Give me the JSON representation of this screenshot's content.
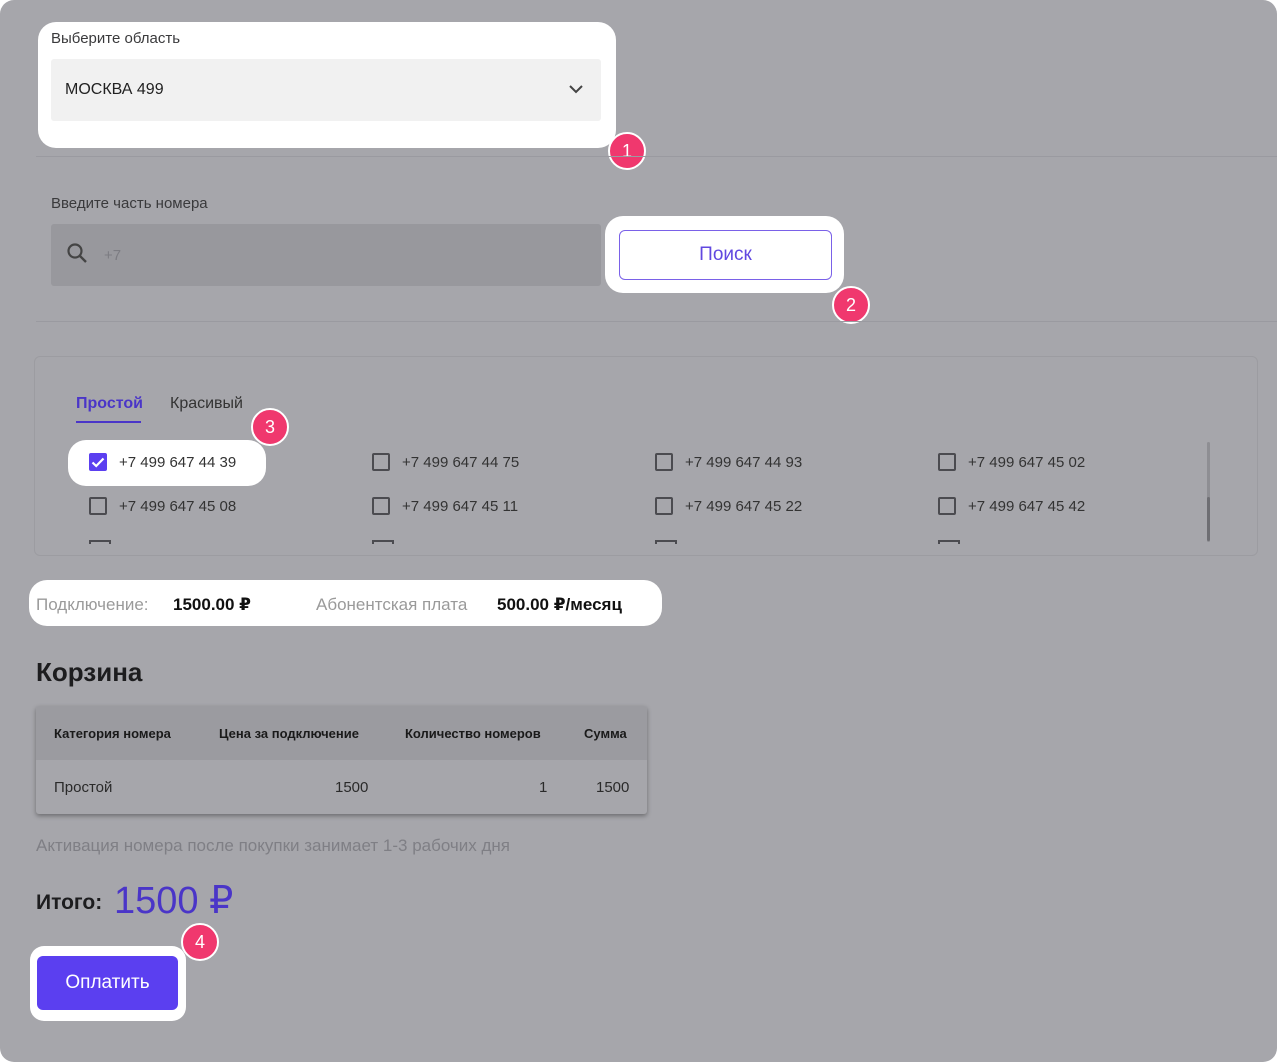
{
  "region": {
    "label": "Выберите область",
    "selected": "МОСКВА 499"
  },
  "search": {
    "label": "Введите часть номера",
    "placeholder": "+7",
    "button_label": "Поиск"
  },
  "tabs": [
    "Простой",
    "Красивый"
  ],
  "numbers": [
    {
      "number": "+7 499 647 44 39",
      "checked": true
    },
    {
      "number": "+7 499 647 44 75",
      "checked": false
    },
    {
      "number": "+7 499 647 44 93",
      "checked": false
    },
    {
      "number": "+7 499 647 45 02",
      "checked": false
    },
    {
      "number": "+7 499 647 45 08",
      "checked": false
    },
    {
      "number": "+7 499 647 45 11",
      "checked": false
    },
    {
      "number": "+7 499 647 45 22",
      "checked": false
    },
    {
      "number": "+7 499 647 45 42",
      "checked": false
    }
  ],
  "price": {
    "connection_label": "Подключение:",
    "connection_value": "1500.00 ₽",
    "subscription_label": "Абонентская плата",
    "subscription_value": "500.00 ₽/месяц"
  },
  "cart": {
    "title": "Корзина",
    "headers": [
      "Категория номера",
      "Цена за подключение",
      "Количество номеров",
      "Сумма"
    ],
    "rows": [
      [
        "Простой",
        "1500",
        "1",
        "1500"
      ]
    ]
  },
  "activation_note": "Активация номера после покупки занимает 1-3 рабочих дня",
  "total": {
    "label": "Итого:",
    "value": "1500 ₽"
  },
  "pay_button": "Оплатить",
  "badges": [
    "1",
    "2",
    "3",
    "4"
  ],
  "colors": {
    "accent": "#5b3ff0",
    "badge": "#f0386e"
  },
  "icons": {
    "search": "search-icon",
    "dropdown": "chevron-down-icon",
    "check": "check-icon"
  }
}
